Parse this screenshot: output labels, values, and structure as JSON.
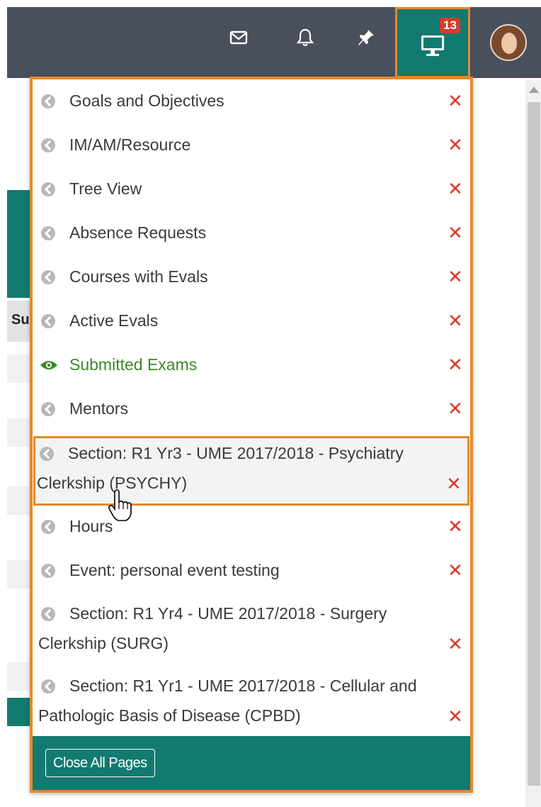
{
  "topbar": {
    "notification_count": "13",
    "accent": "#127a70",
    "highlight": "#e38a2b"
  },
  "background": {
    "column_header_partial": "Su"
  },
  "dropdown": {
    "items": [
      {
        "label": "Goals and Objectives",
        "icon": "chevron-left-circle-icon"
      },
      {
        "label": "IM/AM/Resource",
        "icon": "chevron-left-circle-icon"
      },
      {
        "label": "Tree View",
        "icon": "chevron-left-circle-icon"
      },
      {
        "label": "Absence Requests",
        "icon": "chevron-left-circle-icon"
      },
      {
        "label": "Courses with Evals",
        "icon": "chevron-left-circle-icon"
      },
      {
        "label": "Active Evals",
        "icon": "chevron-left-circle-icon"
      },
      {
        "label": "Submitted Exams",
        "icon": "eye-icon",
        "active": true
      },
      {
        "label": "Mentors",
        "icon": "chevron-left-circle-icon"
      },
      {
        "line1": "Section: R1 Yr3 - UME 2017/2018 - Psychiatry",
        "line2": "Clerkship (PSYCHY)",
        "icon": "chevron-left-circle-icon",
        "hovered": true
      },
      {
        "label": "Hours",
        "icon": "chevron-left-circle-icon"
      },
      {
        "label": "Event: personal event testing",
        "icon": "chevron-left-circle-icon"
      },
      {
        "line1": "Section: R1 Yr4 - UME 2017/2018 - Surgery",
        "line2": "Clerkship (SURG)",
        "icon": "chevron-left-circle-icon"
      },
      {
        "line1": "Section: R1 Yr1 - UME 2017/2018 - Cellular and",
        "line2": "Pathologic Basis of Disease (CPBD)",
        "icon": "chevron-left-circle-icon"
      }
    ],
    "close_symbol": "✕",
    "close_all_label": "Close All Pages"
  }
}
